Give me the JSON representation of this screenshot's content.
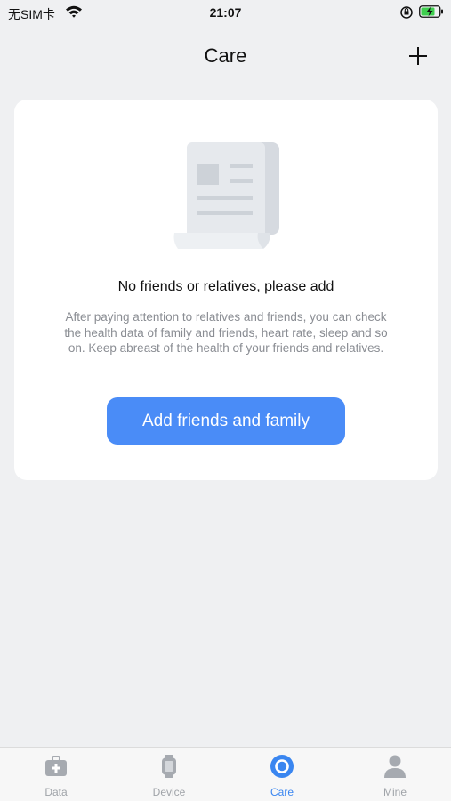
{
  "status_bar": {
    "carrier": "无SIM卡",
    "time": "21:07"
  },
  "nav": {
    "title": "Care",
    "add_icon": "plus-icon"
  },
  "empty_state": {
    "icon": "document-icon",
    "title": "No friends or relatives, please add",
    "description": "After paying attention to relatives and friends, you can check the health data of family and friends, heart rate, sleep and so on. Keep abreast of the health of your friends and relatives.",
    "button_label": "Add friends and family"
  },
  "tabs": [
    {
      "label": "Data",
      "icon": "medical-kit-icon",
      "active": false
    },
    {
      "label": "Device",
      "icon": "watch-icon",
      "active": false
    },
    {
      "label": "Care",
      "icon": "care-ring-icon",
      "active": true
    },
    {
      "label": "Mine",
      "icon": "person-icon",
      "active": false
    }
  ],
  "colors": {
    "accent": "#4a8cf7",
    "background": "#eff0f2",
    "tab_active": "#3a86f0",
    "tab_inactive": "#9fa3a8"
  }
}
